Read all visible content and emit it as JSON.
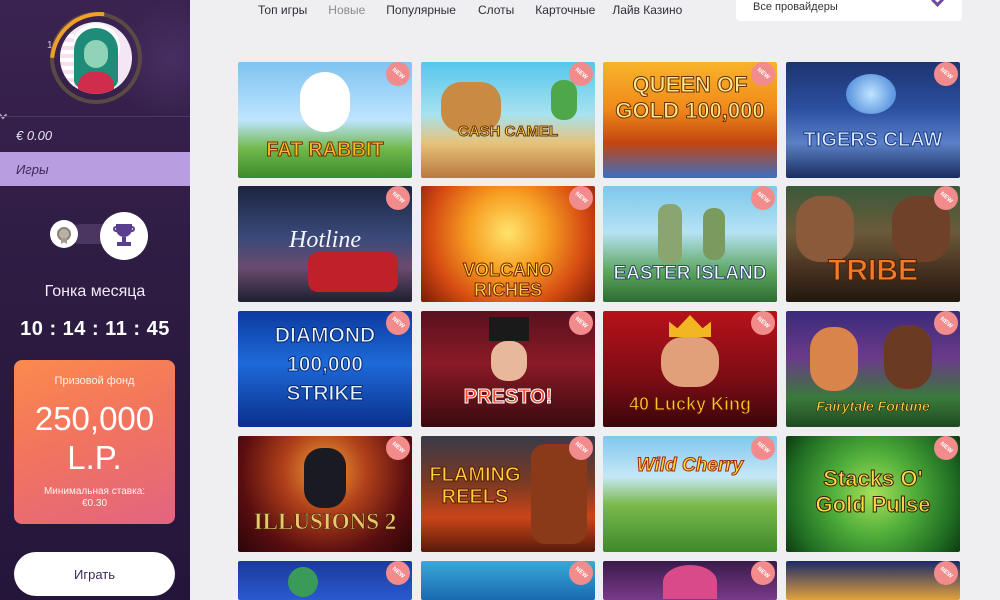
{
  "sidebar": {
    "level": "1",
    "balance": "€ 0.00",
    "games_label": "Игры",
    "race_title": "Гонка месяца",
    "timer": "10 : 14 : 11 : 45",
    "prize": {
      "label": "Призовой фонд",
      "amount": "250,000",
      "unit": "L.P.",
      "min_bet_label": "Минимальная ставка:",
      "min_bet_value": "€0.30"
    },
    "play_label": "Играть"
  },
  "nav": {
    "items": [
      {
        "label": "Топ игры",
        "active": false
      },
      {
        "label": "Новые",
        "active": true
      },
      {
        "label": "Популярные",
        "active": false
      },
      {
        "label": "Слоты",
        "active": false
      },
      {
        "label": "Карточные",
        "active": false
      },
      {
        "label": "Лайв Казино",
        "active": false
      }
    ],
    "provider_select": "Все провайдеры"
  },
  "badge_text": "NEW",
  "games": [
    {
      "title": "FAT RABBIT"
    },
    {
      "title": "CASH CAMEL"
    },
    {
      "title": "QUEEN OF GOLD 100,000"
    },
    {
      "title": "TIGERS CLAW"
    },
    {
      "title": "Hotline"
    },
    {
      "title": "VOLCANO RICHES"
    },
    {
      "title": "EASTER ISLAND"
    },
    {
      "title": "TRIBE"
    },
    {
      "title": "DIAMOND 100,000 STRIKE"
    },
    {
      "title": "PRESTO!"
    },
    {
      "title": "40 Lucky King"
    },
    {
      "title": "Fairytale Fortune"
    },
    {
      "title": "ILLUSIONS 2"
    },
    {
      "title": "FLAMING REELS"
    },
    {
      "title": "Wild Cherry"
    },
    {
      "title": "Stacks O' Gold Pulse"
    }
  ]
}
